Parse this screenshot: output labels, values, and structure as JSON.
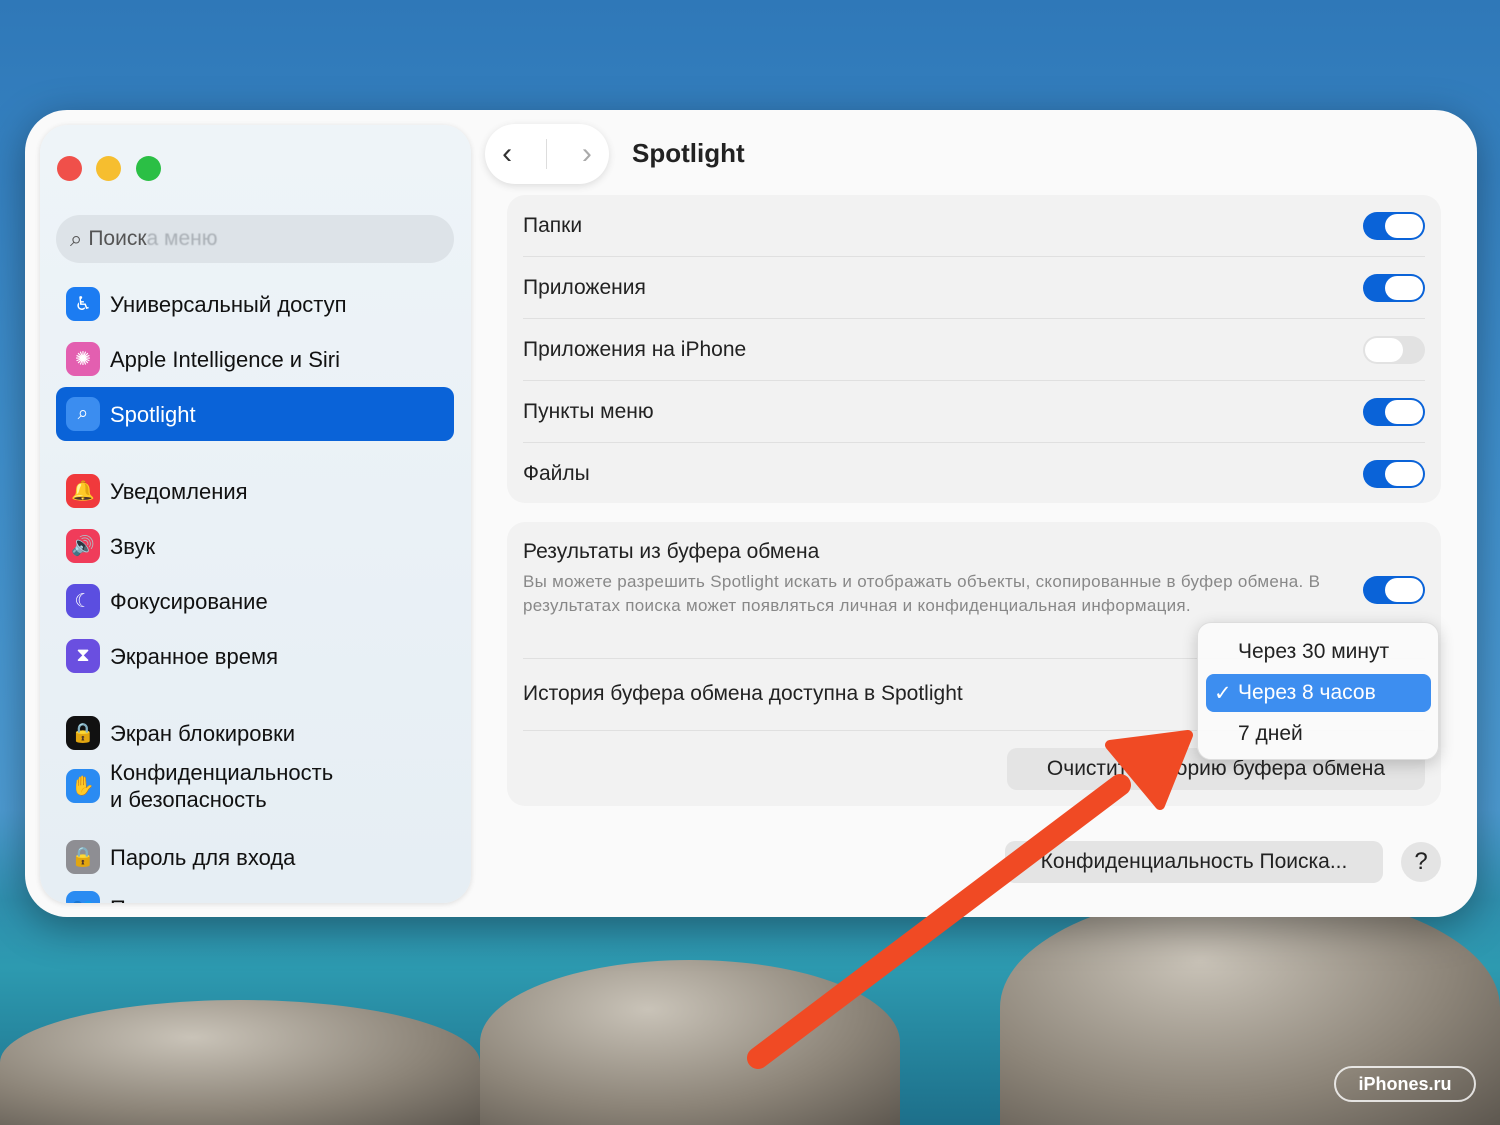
{
  "sidebar": {
    "search_placeholder": "Поиск",
    "search_ghost": "а меню",
    "items": [
      {
        "label": "Универсальный доступ",
        "color": "#1c7cf2",
        "icon": "♿"
      },
      {
        "label": "Apple Intelligence и Siri",
        "color": "#e35fb0",
        "icon": "✺"
      },
      {
        "label": "Spotlight",
        "color": "#3b8df0",
        "icon": "⌕"
      },
      {
        "label": "Уведомления",
        "color": "#f0393c",
        "icon": "🔔"
      },
      {
        "label": "Звук",
        "color": "#f03c5a",
        "icon": "🔊"
      },
      {
        "label": "Фокусирование",
        "color": "#5b4ee0",
        "icon": "☾"
      },
      {
        "label": "Экранное время",
        "color": "#6a4fe0",
        "icon": "⧗"
      },
      {
        "label": "Экран блокировки",
        "color": "#111111",
        "icon": "🔒"
      },
      {
        "label": "Конфиденциальность",
        "label2": "и безопасность",
        "color": "#2a8bf2",
        "icon": "✋"
      },
      {
        "label": "Пароль для входа",
        "color": "#8e8e93",
        "icon": "🔒"
      },
      {
        "label": "Пользователи и группы",
        "color": "#2a8bf2",
        "icon": "👥"
      }
    ]
  },
  "header": {
    "title": "Spotlight",
    "back": "‹",
    "forward": "›"
  },
  "categories": [
    {
      "label": "Папки",
      "on": true
    },
    {
      "label": "Приложения",
      "on": true
    },
    {
      "label": "Приложения на iPhone",
      "on": false
    },
    {
      "label": "Пункты меню",
      "on": true
    },
    {
      "label": "Файлы",
      "on": true
    }
  ],
  "clipboard": {
    "title": "Результаты из буфера обмена",
    "description": "Вы можете разрешить Spotlight искать и отображать объекты, скопированные в буфер обмена. В результатах поиска может появляться личная и конфиденциальная информация.",
    "on": true,
    "history_label": "История буфера обмена доступна в Spotlight",
    "clear_button": "Очистить историю буфера обмена",
    "options": [
      "Через 30 минут",
      "Через 8 часов",
      "7 дней"
    ],
    "selected": "Через 8 часов"
  },
  "footer": {
    "privacy_button": "Конфиденциальность Поиска...",
    "help": "?"
  },
  "watermark": "iPhones.ru"
}
